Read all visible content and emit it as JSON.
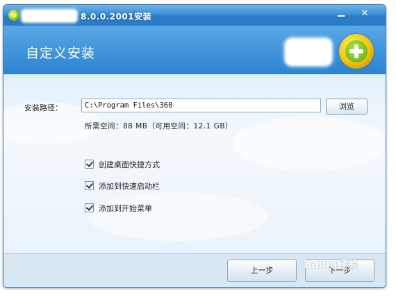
{
  "window": {
    "title": "8.0.0.2001安装",
    "minimize_glyph": "—",
    "close_glyph": "✕",
    "header_title": "自定义安装",
    "logo_icon": "360-plus-logo-icon"
  },
  "form": {
    "path_label": "安装路径：",
    "path_value": "C:\\Program Files\\360",
    "browse_label": "浏览",
    "space_info": "所需空间：88 MB（可用空间：12.1 GB）"
  },
  "options": [
    {
      "label": "创建桌面快捷方式",
      "checked": true
    },
    {
      "label": "添加到快速启动栏",
      "checked": true
    },
    {
      "label": "添加到开始菜单",
      "checked": true
    }
  ],
  "footer": {
    "prev_label": "上一步",
    "next_label": "下一步",
    "watermark_text": "Baidu经验"
  },
  "colors": {
    "titlebar": "#2b7cc9",
    "header": "#2b83d2",
    "body": "#eaf3fb",
    "logo_ring": "#f3c110",
    "logo_center": "#5ea90f"
  }
}
